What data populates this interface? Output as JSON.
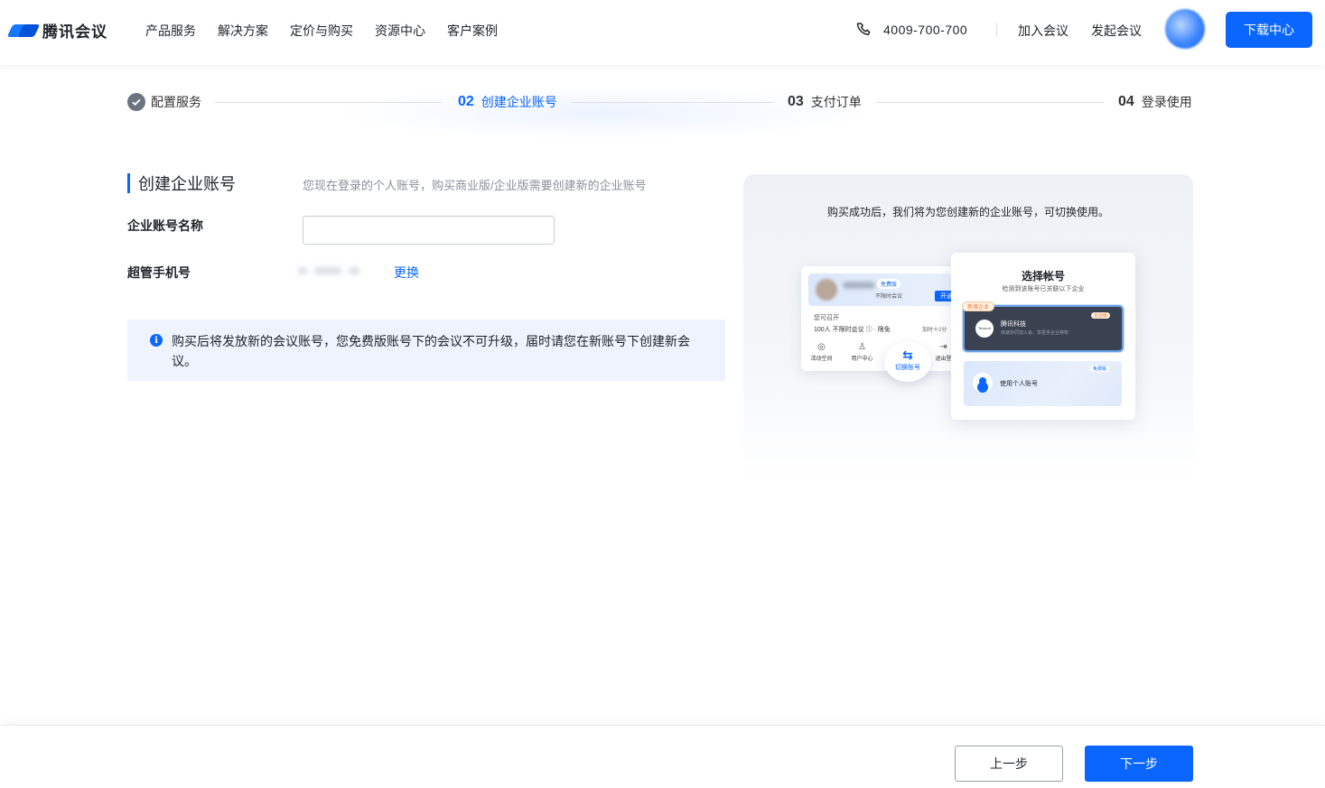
{
  "header": {
    "brand": "腾讯会议",
    "nav": [
      "产品服务",
      "解决方案",
      "定价与购买",
      "资源中心",
      "客户案例"
    ],
    "phone": "4009-700-700",
    "join_meeting": "加入会议",
    "start_meeting": "发起会议",
    "download": "下载中心"
  },
  "steps": [
    {
      "num": "",
      "label": "配置服务",
      "state": "done"
    },
    {
      "num": "02",
      "label": "创建企业账号",
      "state": "active"
    },
    {
      "num": "03",
      "label": "支付订单",
      "state": "todo"
    },
    {
      "num": "04",
      "label": "登录使用",
      "state": "todo"
    }
  ],
  "form": {
    "title": "创建企业账号",
    "description": "您现在登录的个人账号，购买商业版/企业版需要创建新的企业账号",
    "account_name_label": "企业账号名称",
    "account_name_value": "",
    "phone_label": "超管手机号",
    "change_link": "更换"
  },
  "notice": {
    "icon": "info-icon",
    "text": "购买后将发放新的会议账号，您免费版账号下的会议不可升级，届时请您在新账号下创建新会议。"
  },
  "illustration": {
    "caption": "购买成功后，我们将为您创建新的企业账号，可切换使用。",
    "left_card": {
      "badge": "免费版",
      "meeting": "不限时会议",
      "open": "开通",
      "subtitle": "您可召开",
      "row": "100人  不限时会议 ⓘ · 限免",
      "row_right": "加时十2分",
      "icons": [
        "活动空间",
        "用户中心",
        "",
        "退出登"
      ]
    },
    "switch_label": "切换账号",
    "right_card": {
      "title": "选择帐号",
      "subtitle": "检测到该账号已关联以下企业",
      "new_tag": "新增企业",
      "enterprise_name": "腾讯科技",
      "enterprise_desc": "快速协同加入会，享更多企业特权",
      "enterprise_tag": "企业版",
      "personal": "使用个人账号",
      "personal_tag": "免费版"
    }
  },
  "footer": {
    "prev": "上一步",
    "next": "下一步"
  },
  "colors": {
    "primary": "#0a66ff",
    "notice_bg": "#eef3fd"
  }
}
